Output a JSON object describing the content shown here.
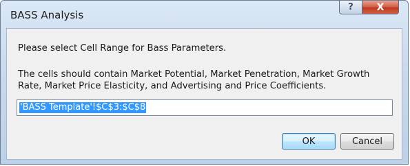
{
  "window": {
    "title": "BASS Analysis",
    "help_glyph": "?",
    "close_glyph": "X"
  },
  "dialog": {
    "prompt": "Please select Cell Range for Bass Parameters.",
    "description_line1": "The cells should contain Market Potential, Market Penetration, Market Growth",
    "description_line2": "Rate, Market Price Elasticity, and Advertising and Price Coefficients.",
    "range_value": "'BASS Template'!$C$3:$C$8",
    "ok_label": "OK",
    "cancel_label": "Cancel"
  }
}
